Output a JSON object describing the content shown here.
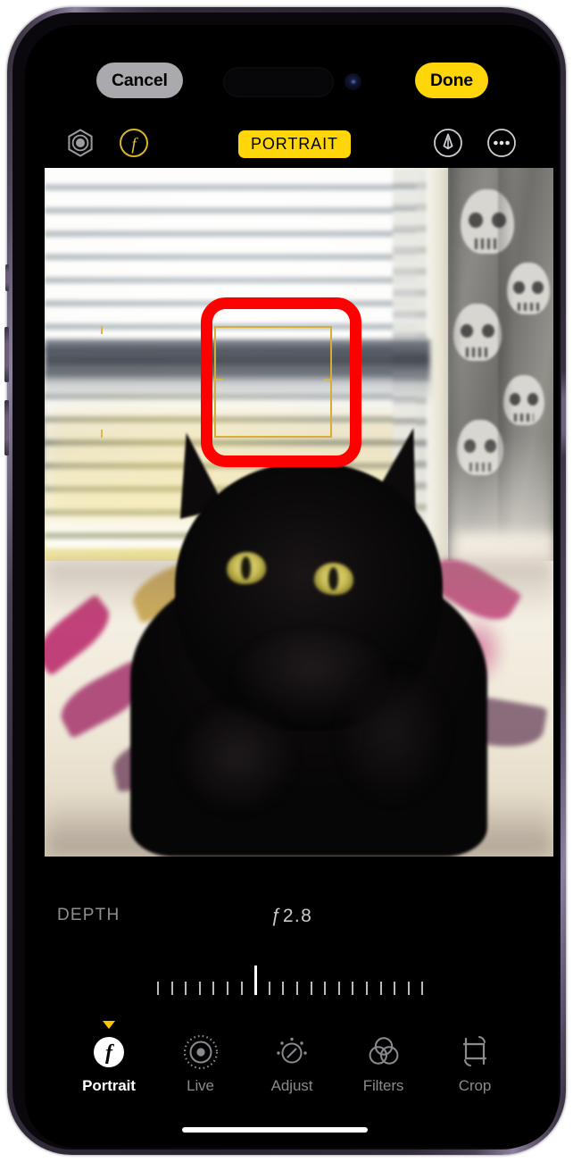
{
  "device": {
    "name": "iPhone",
    "frame_color": "#3a3242",
    "screen_background": "#000000"
  },
  "topbar": {
    "cancel_label": "Cancel",
    "cancel_bg": "#a9a9ae",
    "done_label": "Done",
    "done_bg": "#ffd60a"
  },
  "toolrow": {
    "lighting_icon": "lighting-effect-icon",
    "aperture_icon": "aperture-f-icon",
    "mode_badge": "PORTRAIT",
    "mode_badge_bg": "#ffd60a",
    "markup_icon": "markup-pen-icon",
    "more_icon": "more-ellipsis-icon"
  },
  "photo": {
    "subject": "black cat",
    "annotation": {
      "shape": "rounded-rectangle",
      "color": "#ff0000",
      "purpose": "highlights the portrait focus box"
    },
    "focus_box": {
      "color": "#d8ad34",
      "label": "depth focus selector"
    }
  },
  "depth": {
    "label": "DEPTH",
    "value": "ƒ2.8",
    "slider": {
      "ticks_total": 20,
      "center_tick_index": 7,
      "min_label": "",
      "max_label": ""
    }
  },
  "tabs": [
    {
      "label": "Portrait",
      "icon": "portrait-f-icon",
      "active": true
    },
    {
      "label": "Live",
      "icon": "live-photo-icon",
      "active": false
    },
    {
      "label": "Adjust",
      "icon": "adjust-dial-icon",
      "active": false
    },
    {
      "label": "Filters",
      "icon": "filters-circles-icon",
      "active": false
    },
    {
      "label": "Crop",
      "icon": "crop-rotate-icon",
      "active": false
    }
  ],
  "colors": {
    "accent_yellow": "#ffd60a",
    "caret_yellow": "#ffc300",
    "annotation_red": "#ff0000",
    "inactive_gray": "#8a8a8f"
  }
}
